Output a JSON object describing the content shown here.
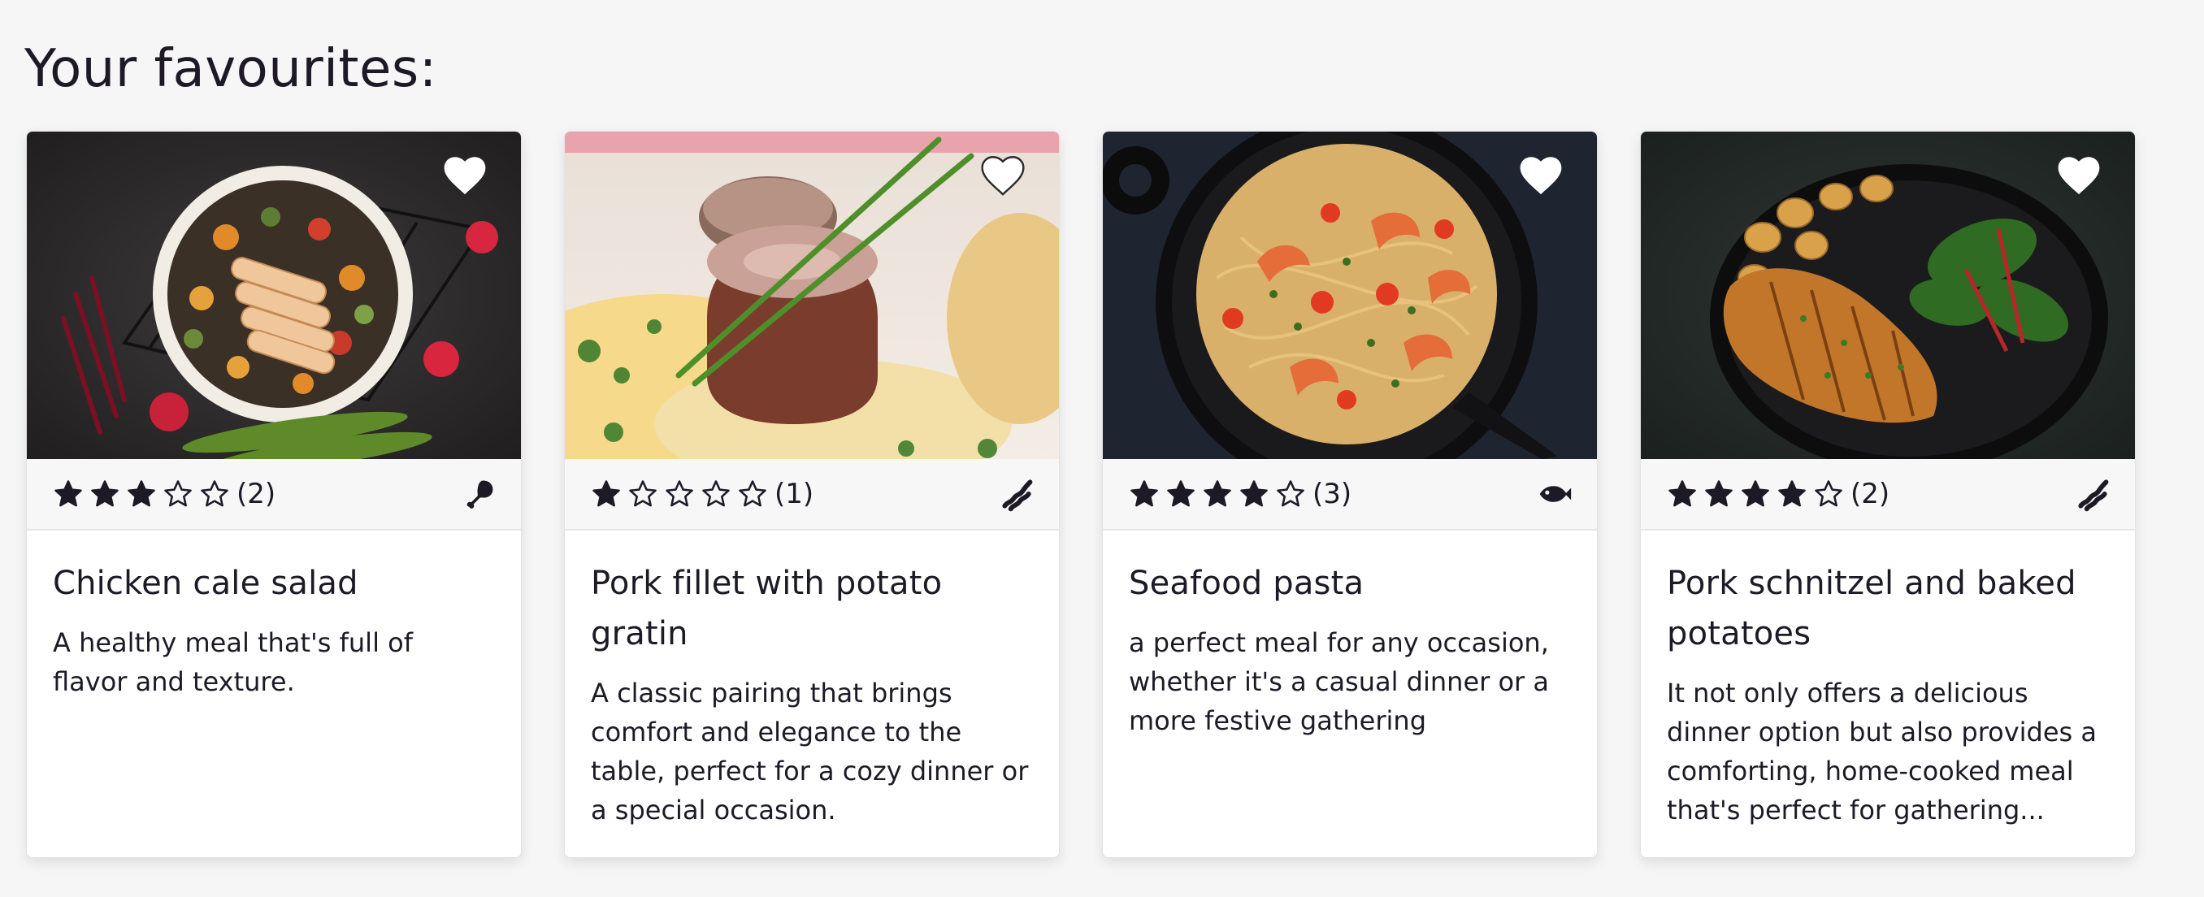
{
  "page": {
    "title": "Your favourites:"
  },
  "cards": [
    {
      "title": "Chicken cale salad",
      "description": "A healthy meal that's full of flavor and texture.",
      "rating": 3,
      "max_rating": 5,
      "rating_count": "(2)",
      "category_icon": "chicken-leg-icon",
      "favourite": true
    },
    {
      "title": "Pork fillet with potato gratin",
      "description": "A classic pairing that brings comfort and elegance to the table, perfect for a cozy dinner or a special occasion.",
      "rating": 1,
      "max_rating": 5,
      "rating_count": "(1)",
      "category_icon": "bacon-icon",
      "favourite": true
    },
    {
      "title": "Seafood pasta",
      "description": "a perfect meal for any occasion, whether it's a casual dinner or a more festive gathering",
      "rating": 4,
      "max_rating": 5,
      "rating_count": "(3)",
      "category_icon": "fish-icon",
      "favourite": true
    },
    {
      "title": "Pork schnitzel and baked potatoes",
      "description": "It not only offers a delicious dinner option but also provides a comforting, home-cooked meal that's perfect for gathering...",
      "rating": 4,
      "max_rating": 5,
      "rating_count": "(2)",
      "category_icon": "bacon-icon",
      "favourite": true
    }
  ],
  "colors": {
    "background": "#f6f6f7",
    "text": "#1d1a26",
    "meta_bar": "#f7f7f8"
  }
}
